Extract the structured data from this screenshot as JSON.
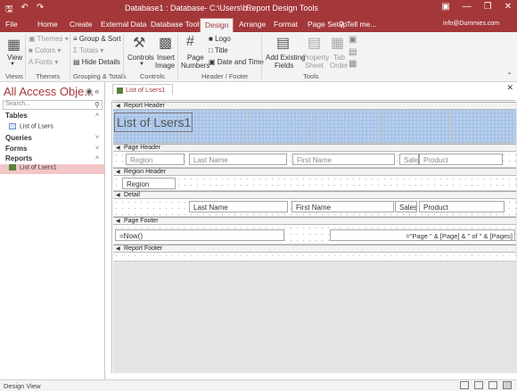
{
  "titlebar": {
    "title": "Database1 : Database- C:\\Users\\b...",
    "contextual_label": "Report Design Tools",
    "qat_icons": [
      "save-icon",
      "undo-icon",
      "redo-icon"
    ],
    "window_controls": [
      "ribbon-display-icon",
      "minimize-icon",
      "restore-icon",
      "close-icon"
    ]
  },
  "tabs": {
    "items": [
      "File",
      "Home",
      "Create",
      "External Data",
      "Database Tools",
      "Design",
      "Arrange",
      "Format",
      "Page Setup"
    ],
    "active": "Design",
    "tell_me": "Tell me...",
    "account": "info@Dummies.com"
  },
  "ribbon": {
    "views": {
      "button": "View",
      "group": "Views"
    },
    "themes": {
      "themes": "Themes",
      "colors": "Colors",
      "fonts": "Fonts",
      "group": "Themes"
    },
    "grouping": {
      "group_sort": "Group & Sort",
      "totals": "Totals",
      "hide_details": "Hide Details",
      "group": "Grouping & Totals"
    },
    "controls": {
      "controls": "Controls",
      "insert_image_1": "Insert",
      "insert_image_2": "Image",
      "group": "Controls"
    },
    "header_footer": {
      "page_numbers_1": "Page",
      "page_numbers_2": "Numbers",
      "logo": "Logo",
      "title": "Title",
      "date_time": "Date and Time",
      "group": "Header / Footer"
    },
    "tools": {
      "add_fields_1": "Add Existing",
      "add_fields_2": "Fields",
      "property_sheet_1": "Property",
      "property_sheet_2": "Sheet",
      "tab_order_1": "Tab",
      "tab_order_2": "Order",
      "group": "Tools"
    }
  },
  "nav": {
    "title": "All Access Obje...",
    "search_placeholder": "Search...",
    "sections": [
      {
        "label": "Tables",
        "items": [
          "List of Lsers"
        ]
      },
      {
        "label": "Queries",
        "items": []
      },
      {
        "label": "Forms",
        "items": []
      },
      {
        "label": "Reports",
        "items": [
          "List of Lsers1"
        ]
      }
    ]
  },
  "document": {
    "tab_label": "List of Lsers1",
    "bands": {
      "report_header": "Report Header",
      "page_header": "Page Header",
      "region_header": "Region Header",
      "detail": "Detail",
      "page_footer": "Page Footer",
      "report_footer": "Report Footer"
    },
    "report_title": "List of Lsers1",
    "page_header_labels": [
      "Region",
      "Last Name",
      "First Name",
      "Sales",
      "Product"
    ],
    "region_header_field": "Region",
    "detail_fields": [
      "Last Name",
      "First Name",
      "Sales",
      "Product"
    ],
    "page_footer": {
      "date_expr": "=Now()",
      "page_expr": "=\"Page \" & [Page] & \" of \" & [Pages]"
    }
  },
  "statusbar": {
    "text": "Design View"
  },
  "colors": {
    "accent": "#a4373a",
    "selected_nav": "#f4c6c7",
    "header_section": "#a9c4e8"
  }
}
